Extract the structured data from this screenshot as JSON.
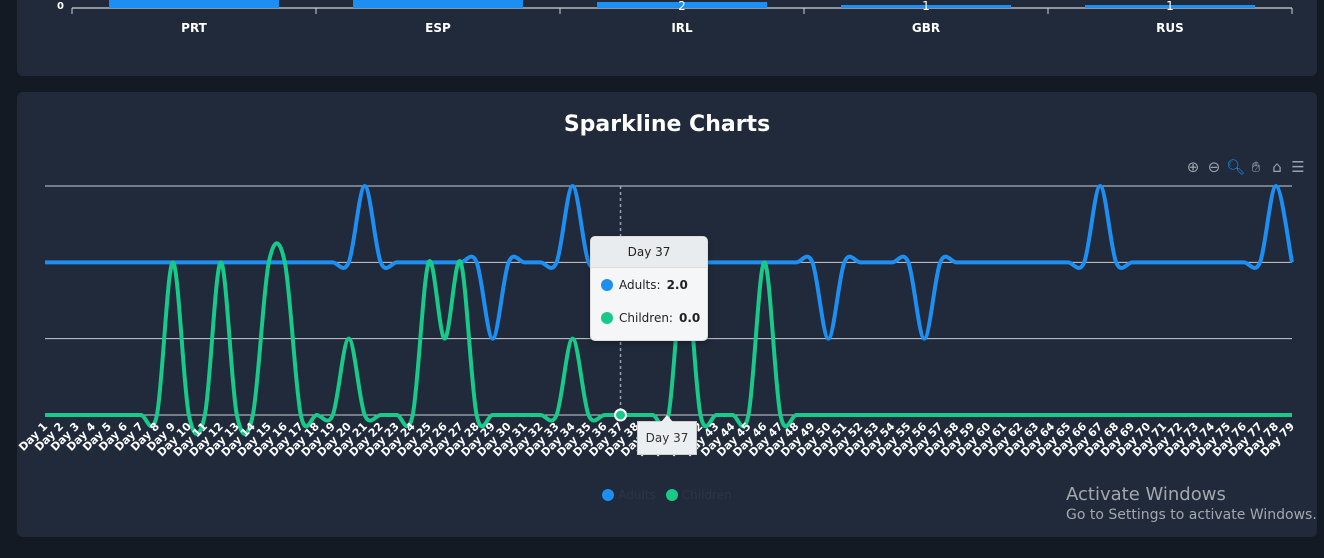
{
  "top_chart": {
    "chart_data": {
      "type": "bar",
      "categories": [
        "PRT",
        "ESP",
        "IRL",
        "GBR",
        "RUS"
      ],
      "values": [
        null,
        null,
        2,
        1,
        1
      ],
      "data_labels": [
        "",
        "",
        "2",
        "1",
        "1"
      ],
      "ytick_zero": "0",
      "color": "#1d8ff2"
    }
  },
  "main_chart": {
    "title": "Sparkline Charts",
    "toolbar": [
      "zoom-in-icon",
      "zoom-out-icon",
      "zoom-icon",
      "pan-hand-icon",
      "home-icon",
      "menu-icon"
    ],
    "tooltip": {
      "header": "Day 37",
      "rows": [
        {
          "label": "Adults:",
          "value": "2.0"
        },
        {
          "label": "Children:",
          "value": "0.0"
        }
      ]
    },
    "xaxis_tooltip": "Day 37",
    "legend": [
      {
        "label": "Adults",
        "color": "#1d8ff2"
      },
      {
        "label": "Children",
        "color": "#18c98a"
      }
    ],
    "chart_data": {
      "type": "line",
      "title": "Sparkline Charts",
      "ylim": [
        0,
        3
      ],
      "categories": [
        "Day 1",
        "Day 2",
        "Day 3",
        "Day 4",
        "Day 5",
        "Day 6",
        "Day 7",
        "Day 8",
        "Day 9",
        "Day 10",
        "Day 11",
        "Day 12",
        "Day 13",
        "Day 14",
        "Day 15",
        "Day 16",
        "Day 17",
        "Day 18",
        "Day 19",
        "Day 20",
        "Day 21",
        "Day 22",
        "Day 23",
        "Day 24",
        "Day 25",
        "Day 26",
        "Day 27",
        "Day 28",
        "Day 29",
        "Day 30",
        "Day 31",
        "Day 32",
        "Day 33",
        "Day 34",
        "Day 35",
        "Day 36",
        "Day 37",
        "Day 38",
        "Day 39",
        "Day 40",
        "Day 41",
        "Day 42",
        "Day 43",
        "Day 44",
        "Day 45",
        "Day 46",
        "Day 47",
        "Day 48",
        "Day 49",
        "Day 50",
        "Day 51",
        "Day 52",
        "Day 53",
        "Day 54",
        "Day 55",
        "Day 56",
        "Day 57",
        "Day 58",
        "Day 59",
        "Day 60",
        "Day 61",
        "Day 62",
        "Day 63",
        "Day 64",
        "Day 65",
        "Day 66",
        "Day 67",
        "Day 68",
        "Day 69",
        "Day 70",
        "Day 71",
        "Day 72",
        "Day 73",
        "Day 74",
        "Day 75",
        "Day 76",
        "Day 77",
        "Day 78",
        "Day 79"
      ],
      "series": [
        {
          "name": "Adults",
          "color": "#1d8ff2",
          "values": [
            2,
            2,
            2,
            2,
            2,
            2,
            2,
            2,
            2,
            2,
            2,
            2,
            2,
            2,
            2,
            2,
            2,
            2,
            2,
            2,
            3,
            2,
            2,
            2,
            2,
            2,
            2,
            2,
            1,
            2,
            2,
            2,
            2,
            3,
            2,
            2,
            2,
            2,
            2,
            2,
            2,
            2,
            2,
            2,
            2,
            2,
            2,
            2,
            2,
            1,
            2,
            2,
            2,
            2,
            2,
            1,
            2,
            2,
            2,
            2,
            2,
            2,
            2,
            2,
            2,
            2,
            3,
            2,
            2,
            2,
            2,
            2,
            2,
            2,
            2,
            2,
            2,
            3,
            2
          ]
        },
        {
          "name": "Children",
          "color": "#18c98a",
          "values": [
            0,
            0,
            0,
            0,
            0,
            0,
            0,
            0,
            2,
            0,
            0,
            2,
            0,
            0,
            2,
            2,
            0,
            0,
            0,
            1,
            0,
            0,
            0,
            0,
            2,
            1,
            2,
            0,
            0,
            0,
            0,
            0,
            0,
            1,
            0,
            0,
            0,
            0,
            0,
            0,
            2,
            0,
            0,
            0,
            0,
            2,
            0,
            0,
            0,
            0,
            0,
            0,
            0,
            0,
            0,
            0,
            0,
            0,
            0,
            0,
            0,
            0,
            0,
            0,
            0,
            0,
            0,
            0,
            0,
            0,
            0,
            0,
            0,
            0,
            0,
            0,
            0,
            0,
            0
          ]
        }
      ]
    }
  },
  "watermark": {
    "line1": "Activate Windows",
    "line2": "Go to Settings to activate Windows."
  }
}
